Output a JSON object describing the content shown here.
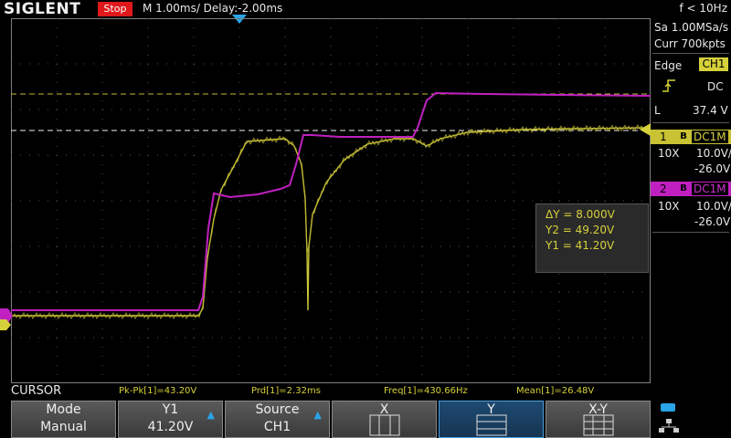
{
  "topbar": {
    "logo": "SIGLENT",
    "run_status": "Stop",
    "timebase": "M 1.00ms/ Delay:-2.00ms",
    "frequency": "f < 10Hz"
  },
  "acquisition": {
    "sample_rate": "Sa 1.00MSa/s",
    "memory": "Curr 700kpts"
  },
  "trigger": {
    "mode": "Edge",
    "source": "CH1",
    "slope_icon": "rising-edge-icon",
    "coupling": "DC",
    "level_label": "L",
    "level": "37.4 V"
  },
  "channels": [
    {
      "num": "1",
      "bw": "B",
      "coupling": "DC1M",
      "probe": "10X",
      "scale": "10.0V/",
      "offset": "-26.0V",
      "color": "#d6d13a"
    },
    {
      "num": "2",
      "bw": "B",
      "coupling": "DC1M",
      "probe": "10X",
      "scale": "10.0V/",
      "offset": "-26.0V",
      "color": "#c020c0"
    }
  ],
  "cursor_readout": {
    "delta": "ΔY = 8.000V",
    "y2": "Y2 = 49.20V",
    "y1": "Y1 = 41.20V"
  },
  "measurements": {
    "label": "CURSOR",
    "pkpk": "Pk-Pk[1]=43.20V",
    "prd": "Prd[1]=2.32ms",
    "freq": "Freq[1]=430.66Hz",
    "mean": "Mean[1]=26.48V"
  },
  "softkeys": [
    {
      "title": "Mode",
      "value": "Manual"
    },
    {
      "title": "Y1",
      "value": "41.20V"
    },
    {
      "title": "Source",
      "value": "CH1"
    },
    {
      "title": "X",
      "value": ""
    },
    {
      "title": "Y",
      "value": ""
    },
    {
      "title": "X-Y",
      "value": ""
    }
  ],
  "colors": {
    "ch1": "#d6d13a",
    "ch2": "#c020c0",
    "accent": "#2aa4e8",
    "stop": "#e0181c"
  }
}
